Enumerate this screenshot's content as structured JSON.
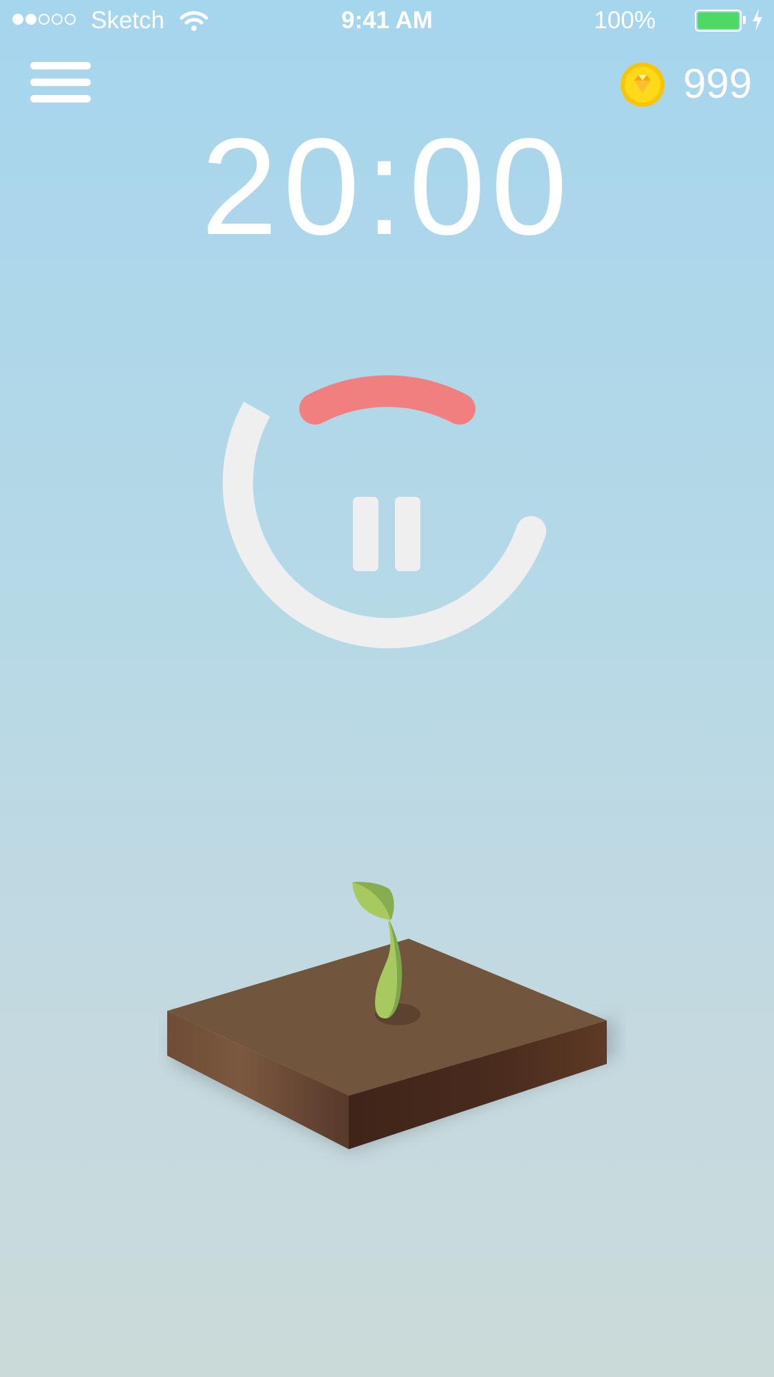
{
  "status_bar": {
    "carrier": "Sketch",
    "time": "9:41 AM",
    "battery_percent": "100%",
    "signal_bars_filled": 2,
    "signal_bars_total": 5,
    "battery_color": "#4cd964"
  },
  "header": {
    "menu_icon": "hamburger-menu-icon",
    "coin_icon": "gold-coin-icon",
    "coin_count": "999"
  },
  "timer": {
    "remaining": "20:00",
    "progress_color": "#f27f7f",
    "track_color": "#efefef",
    "pause_icon": "pause-icon"
  },
  "scene": {
    "plant": "seedling-icon",
    "ground": "soil-block"
  }
}
